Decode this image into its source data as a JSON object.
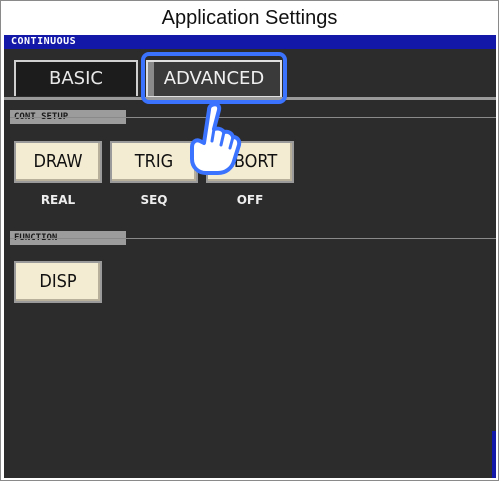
{
  "app_title": "Application Settings",
  "mode": "CONTINUOUS",
  "tabs": {
    "basic": "BASIC",
    "advanced": "ADVANCED"
  },
  "cont_setup": {
    "label": "CONT SETUP",
    "buttons": [
      {
        "label": "DRAW",
        "value": "REAL"
      },
      {
        "label": "TRIG",
        "value": "SEQ"
      },
      {
        "label": "ABORT",
        "value": "OFF"
      }
    ]
  },
  "function": {
    "label": "FUNCTION",
    "disp": "DISP"
  },
  "icons": {
    "pointer": "hand-pointer-icon"
  },
  "colors": {
    "mode_bar": "#1418a8",
    "highlight": "#3b73ff",
    "button_face": "#f4ecd2",
    "screen_bg": "#2c2c2c"
  }
}
